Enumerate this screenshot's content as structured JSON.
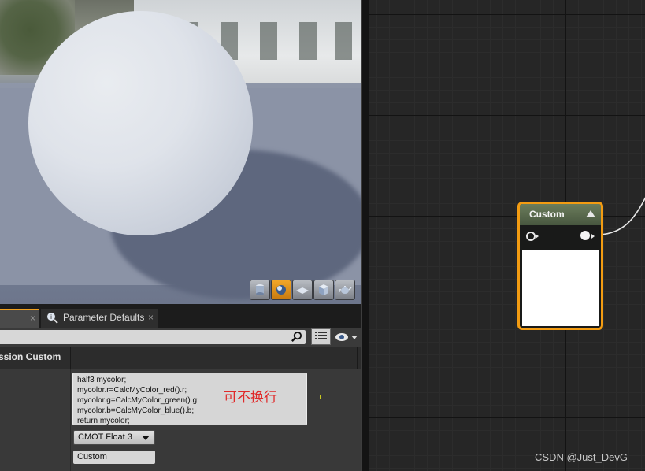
{
  "viewport": {
    "toolbar": [
      {
        "name": "cylinder-preview-icon",
        "active": false
      },
      {
        "name": "sphere-preview-icon",
        "active": true
      },
      {
        "name": "plane-preview-icon",
        "active": false
      },
      {
        "name": "cube-preview-icon",
        "active": false
      },
      {
        "name": "teapot-preview-icon",
        "active": false
      }
    ]
  },
  "details_panel": {
    "tabs": [
      {
        "label": "",
        "close": "×"
      },
      {
        "label": "Parameter Defaults",
        "close": "×"
      }
    ],
    "search": {
      "value": "",
      "placeholder": ""
    },
    "section_title": "ssion Custom",
    "code": [
      "half3 mycolor;",
      "mycolor.r=CalcMyColor_red().r;",
      "mycolor.g=CalcMyColor_green().g;",
      "mycolor.b=CalcMyColor_blue().b;",
      "return mycolor;"
    ],
    "annotation": "可不换行",
    "output_type": "CMOT Float 3",
    "description": "Custom"
  },
  "node": {
    "title": "Custom",
    "header_color": "#5a6b4c",
    "border_color": "#f39c12"
  },
  "watermark": "CSDN @Just_DevG"
}
